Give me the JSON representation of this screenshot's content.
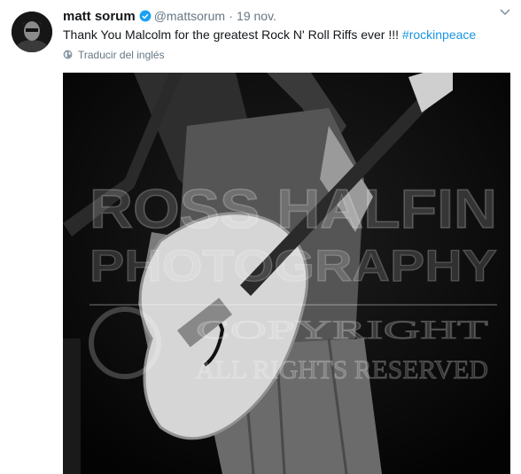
{
  "tweet": {
    "author_name": "matt sorum",
    "handle": "@mattsorum",
    "separator": "·",
    "date": "19 nov.",
    "text_main": "Thank You Malcolm for the greatest Rock N' Roll Riffs ever !!! ",
    "hashtag": "#rockinpeace",
    "translate_label": "Traducir del inglés"
  },
  "photo": {
    "watermark_line1": "ROSS HALFIN",
    "watermark_line2": "PHOTOGRAPHY",
    "watermark_line3": "COPYRIGHT",
    "watermark_line4": "ALL RIGHTS RESERVED"
  },
  "icons": {
    "verified": "verified-badge-icon",
    "globe": "globe-icon",
    "menu": "chevron-down-icon"
  },
  "colors": {
    "link": "#1b95e0",
    "secondary_text": "#657786",
    "verified": "#1da1f2"
  }
}
